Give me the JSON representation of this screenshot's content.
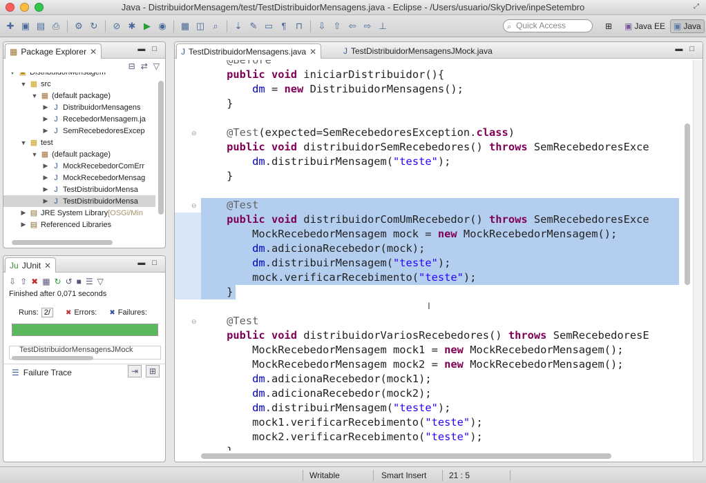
{
  "window": {
    "title": "Java - DistribuidorMensagem/test/TestDistribuidorMensagens.java - Eclipse - /Users/usuario/SkyDrive/inpeSetembro"
  },
  "toolbar": {
    "quick_access_placeholder": "Quick Access",
    "perspectives": [
      "Java EE",
      "Java"
    ]
  },
  "package_explorer": {
    "title": "Package Explorer",
    "tree": [
      {
        "label": "DistribuidorMensagem",
        "depth": 0,
        "expanded": true,
        "kind": "project"
      },
      {
        "label": "src",
        "depth": 1,
        "expanded": true,
        "kind": "src"
      },
      {
        "label": "(default package)",
        "depth": 2,
        "expanded": true,
        "kind": "package"
      },
      {
        "label": "DistribuidorMensagens",
        "depth": 3,
        "expanded": false,
        "kind": "file"
      },
      {
        "label": "RecebedorMensagem.ja",
        "depth": 3,
        "expanded": false,
        "kind": "file"
      },
      {
        "label": "SemRecebedoresExcep",
        "depth": 3,
        "expanded": false,
        "kind": "file"
      },
      {
        "label": "test",
        "depth": 1,
        "expanded": true,
        "kind": "src"
      },
      {
        "label": "(default package)",
        "depth": 2,
        "expanded": true,
        "kind": "package"
      },
      {
        "label": "MockRecebedorComErr",
        "depth": 3,
        "expanded": false,
        "kind": "file"
      },
      {
        "label": "MockRecebedorMensag",
        "depth": 3,
        "expanded": false,
        "kind": "file"
      },
      {
        "label": "TestDistribuidorMensa",
        "depth": 3,
        "expanded": false,
        "kind": "file"
      },
      {
        "label": "TestDistribuidorMensa",
        "depth": 3,
        "expanded": false,
        "kind": "file",
        "selected": true
      },
      {
        "label": "JRE System Library",
        "suffix": "[OSGi/Min",
        "depth": 1,
        "expanded": false,
        "kind": "lib"
      },
      {
        "label": "Referenced Libraries",
        "depth": 1,
        "expanded": false,
        "kind": "lib"
      }
    ]
  },
  "junit": {
    "title": "JUnit",
    "status": "Finished after 0,071 seconds",
    "runs_label": "Runs:",
    "runs_value": "2/",
    "errors_label": "Errors:",
    "failures_label": "Failures:",
    "progress": 1.0,
    "bar_color": "#5cb85c",
    "test_item": "TestDistribuidorMensagensJMock",
    "failure_trace_label": "Failure Trace"
  },
  "editor": {
    "tabs": [
      "TestDistribuidorMensagens.java",
      "TestDistribuidorMensagensJMock.java"
    ],
    "active_tab": 0,
    "lines": [
      {
        "fold": false,
        "sel": false,
        "segs": [
          [
            "an",
            "    @Before"
          ]
        ]
      },
      {
        "fold": false,
        "sel": false,
        "segs": [
          [
            "kw",
            "    public"
          ],
          [
            "",
            " "
          ],
          [
            "kw",
            "void"
          ],
          [
            "",
            " iniciarDistribuidor(){"
          ]
        ]
      },
      {
        "fold": false,
        "sel": false,
        "segs": [
          [
            "",
            "        "
          ],
          [
            "fld",
            "dm"
          ],
          [
            "",
            " = "
          ],
          [
            "kw",
            "new"
          ],
          [
            "",
            " DistribuidorMensagens();"
          ]
        ]
      },
      {
        "fold": false,
        "sel": false,
        "segs": [
          [
            "",
            "    }"
          ]
        ]
      },
      {
        "fold": false,
        "sel": false,
        "segs": [
          [
            "",
            ""
          ]
        ]
      },
      {
        "fold": true,
        "sel": false,
        "segs": [
          [
            "an",
            "    @Test"
          ],
          [
            "",
            "(expected=SemRecebedoresException."
          ],
          [
            "kw",
            "class"
          ],
          [
            "",
            ")"
          ]
        ]
      },
      {
        "fold": false,
        "sel": false,
        "segs": [
          [
            "kw",
            "    public"
          ],
          [
            "",
            " "
          ],
          [
            "kw",
            "void"
          ],
          [
            "",
            " distribuidorSemRecebedores() "
          ],
          [
            "kw",
            "throws"
          ],
          [
            "",
            " SemRecebedoresExce"
          ]
        ]
      },
      {
        "fold": false,
        "sel": false,
        "segs": [
          [
            "",
            "        "
          ],
          [
            "fld",
            "dm"
          ],
          [
            "",
            ".distribuirMensagem("
          ],
          [
            "str",
            "\"teste\""
          ],
          [
            "",
            ");"
          ]
        ]
      },
      {
        "fold": false,
        "sel": false,
        "segs": [
          [
            "",
            "    }"
          ]
        ]
      },
      {
        "fold": false,
        "sel": false,
        "segs": [
          [
            "",
            ""
          ]
        ]
      },
      {
        "fold": true,
        "sel": true,
        "segs": [
          [
            "an",
            "    @Test"
          ]
        ]
      },
      {
        "fold": false,
        "sel": true,
        "segs": [
          [
            "kw",
            "    public"
          ],
          [
            "",
            " "
          ],
          [
            "kw",
            "void"
          ],
          [
            "",
            " distribuidorComUmRecebedor() "
          ],
          [
            "kw",
            "throws"
          ],
          [
            "",
            " SemRecebedoresExce"
          ]
        ]
      },
      {
        "fold": false,
        "sel": true,
        "segs": [
          [
            "",
            "        MockRecebedorMensagem mock = "
          ],
          [
            "kw",
            "new"
          ],
          [
            "",
            " MockRecebedorMensagem();"
          ]
        ]
      },
      {
        "fold": false,
        "sel": true,
        "segs": [
          [
            "",
            "        "
          ],
          [
            "fld",
            "dm"
          ],
          [
            "",
            ".adicionaRecebedor(mock);"
          ]
        ]
      },
      {
        "fold": false,
        "sel": true,
        "segs": [
          [
            "",
            "        "
          ],
          [
            "fld",
            "dm"
          ],
          [
            "",
            ".distribuirMensagem("
          ],
          [
            "str",
            "\"teste\""
          ],
          [
            "",
            ");"
          ]
        ]
      },
      {
        "fold": false,
        "sel": true,
        "segs": [
          [
            "",
            "        mock.verificarRecebimento("
          ],
          [
            "str",
            "\"teste\""
          ],
          [
            "",
            ");"
          ]
        ]
      },
      {
        "fold": false,
        "sel": "partial",
        "segs": [
          [
            "",
            "    }"
          ]
        ]
      },
      {
        "fold": false,
        "sel": false,
        "segs": [
          [
            "",
            ""
          ]
        ]
      },
      {
        "fold": true,
        "sel": false,
        "segs": [
          [
            "an",
            "    @Test"
          ]
        ]
      },
      {
        "fold": false,
        "sel": false,
        "segs": [
          [
            "kw",
            "    public"
          ],
          [
            "",
            " "
          ],
          [
            "kw",
            "void"
          ],
          [
            "",
            " distribuidorVariosRecebedores() "
          ],
          [
            "kw",
            "throws"
          ],
          [
            "",
            " SemRecebedoresE"
          ]
        ]
      },
      {
        "fold": false,
        "sel": false,
        "segs": [
          [
            "",
            "        MockRecebedorMensagem mock1 = "
          ],
          [
            "kw",
            "new"
          ],
          [
            "",
            " MockRecebedorMensagem();"
          ]
        ]
      },
      {
        "fold": false,
        "sel": false,
        "segs": [
          [
            "",
            "        MockRecebedorMensagem mock2 = "
          ],
          [
            "kw",
            "new"
          ],
          [
            "",
            " MockRecebedorMensagem();"
          ]
        ]
      },
      {
        "fold": false,
        "sel": false,
        "segs": [
          [
            "",
            "        "
          ],
          [
            "fld",
            "dm"
          ],
          [
            "",
            ".adicionaRecebedor(mock1);"
          ]
        ]
      },
      {
        "fold": false,
        "sel": false,
        "segs": [
          [
            "",
            "        "
          ],
          [
            "fld",
            "dm"
          ],
          [
            "",
            ".adicionaRecebedor(mock2);"
          ]
        ]
      },
      {
        "fold": false,
        "sel": false,
        "segs": [
          [
            "",
            "        "
          ],
          [
            "fld",
            "dm"
          ],
          [
            "",
            ".distribuirMensagem("
          ],
          [
            "str",
            "\"teste\""
          ],
          [
            "",
            ");"
          ]
        ]
      },
      {
        "fold": false,
        "sel": false,
        "segs": [
          [
            "",
            "        mock1.verificarRecebimento("
          ],
          [
            "str",
            "\"teste\""
          ],
          [
            "",
            ");"
          ]
        ]
      },
      {
        "fold": false,
        "sel": false,
        "segs": [
          [
            "",
            "        mock2.verificarRecebimento("
          ],
          [
            "str",
            "\"teste\""
          ],
          [
            "",
            ");"
          ]
        ]
      },
      {
        "fold": false,
        "sel": false,
        "segs": [
          [
            "",
            "    }"
          ]
        ]
      }
    ]
  },
  "status": {
    "writable": "Writable",
    "insert_mode": "Smart Insert",
    "position": "21 : 5"
  }
}
